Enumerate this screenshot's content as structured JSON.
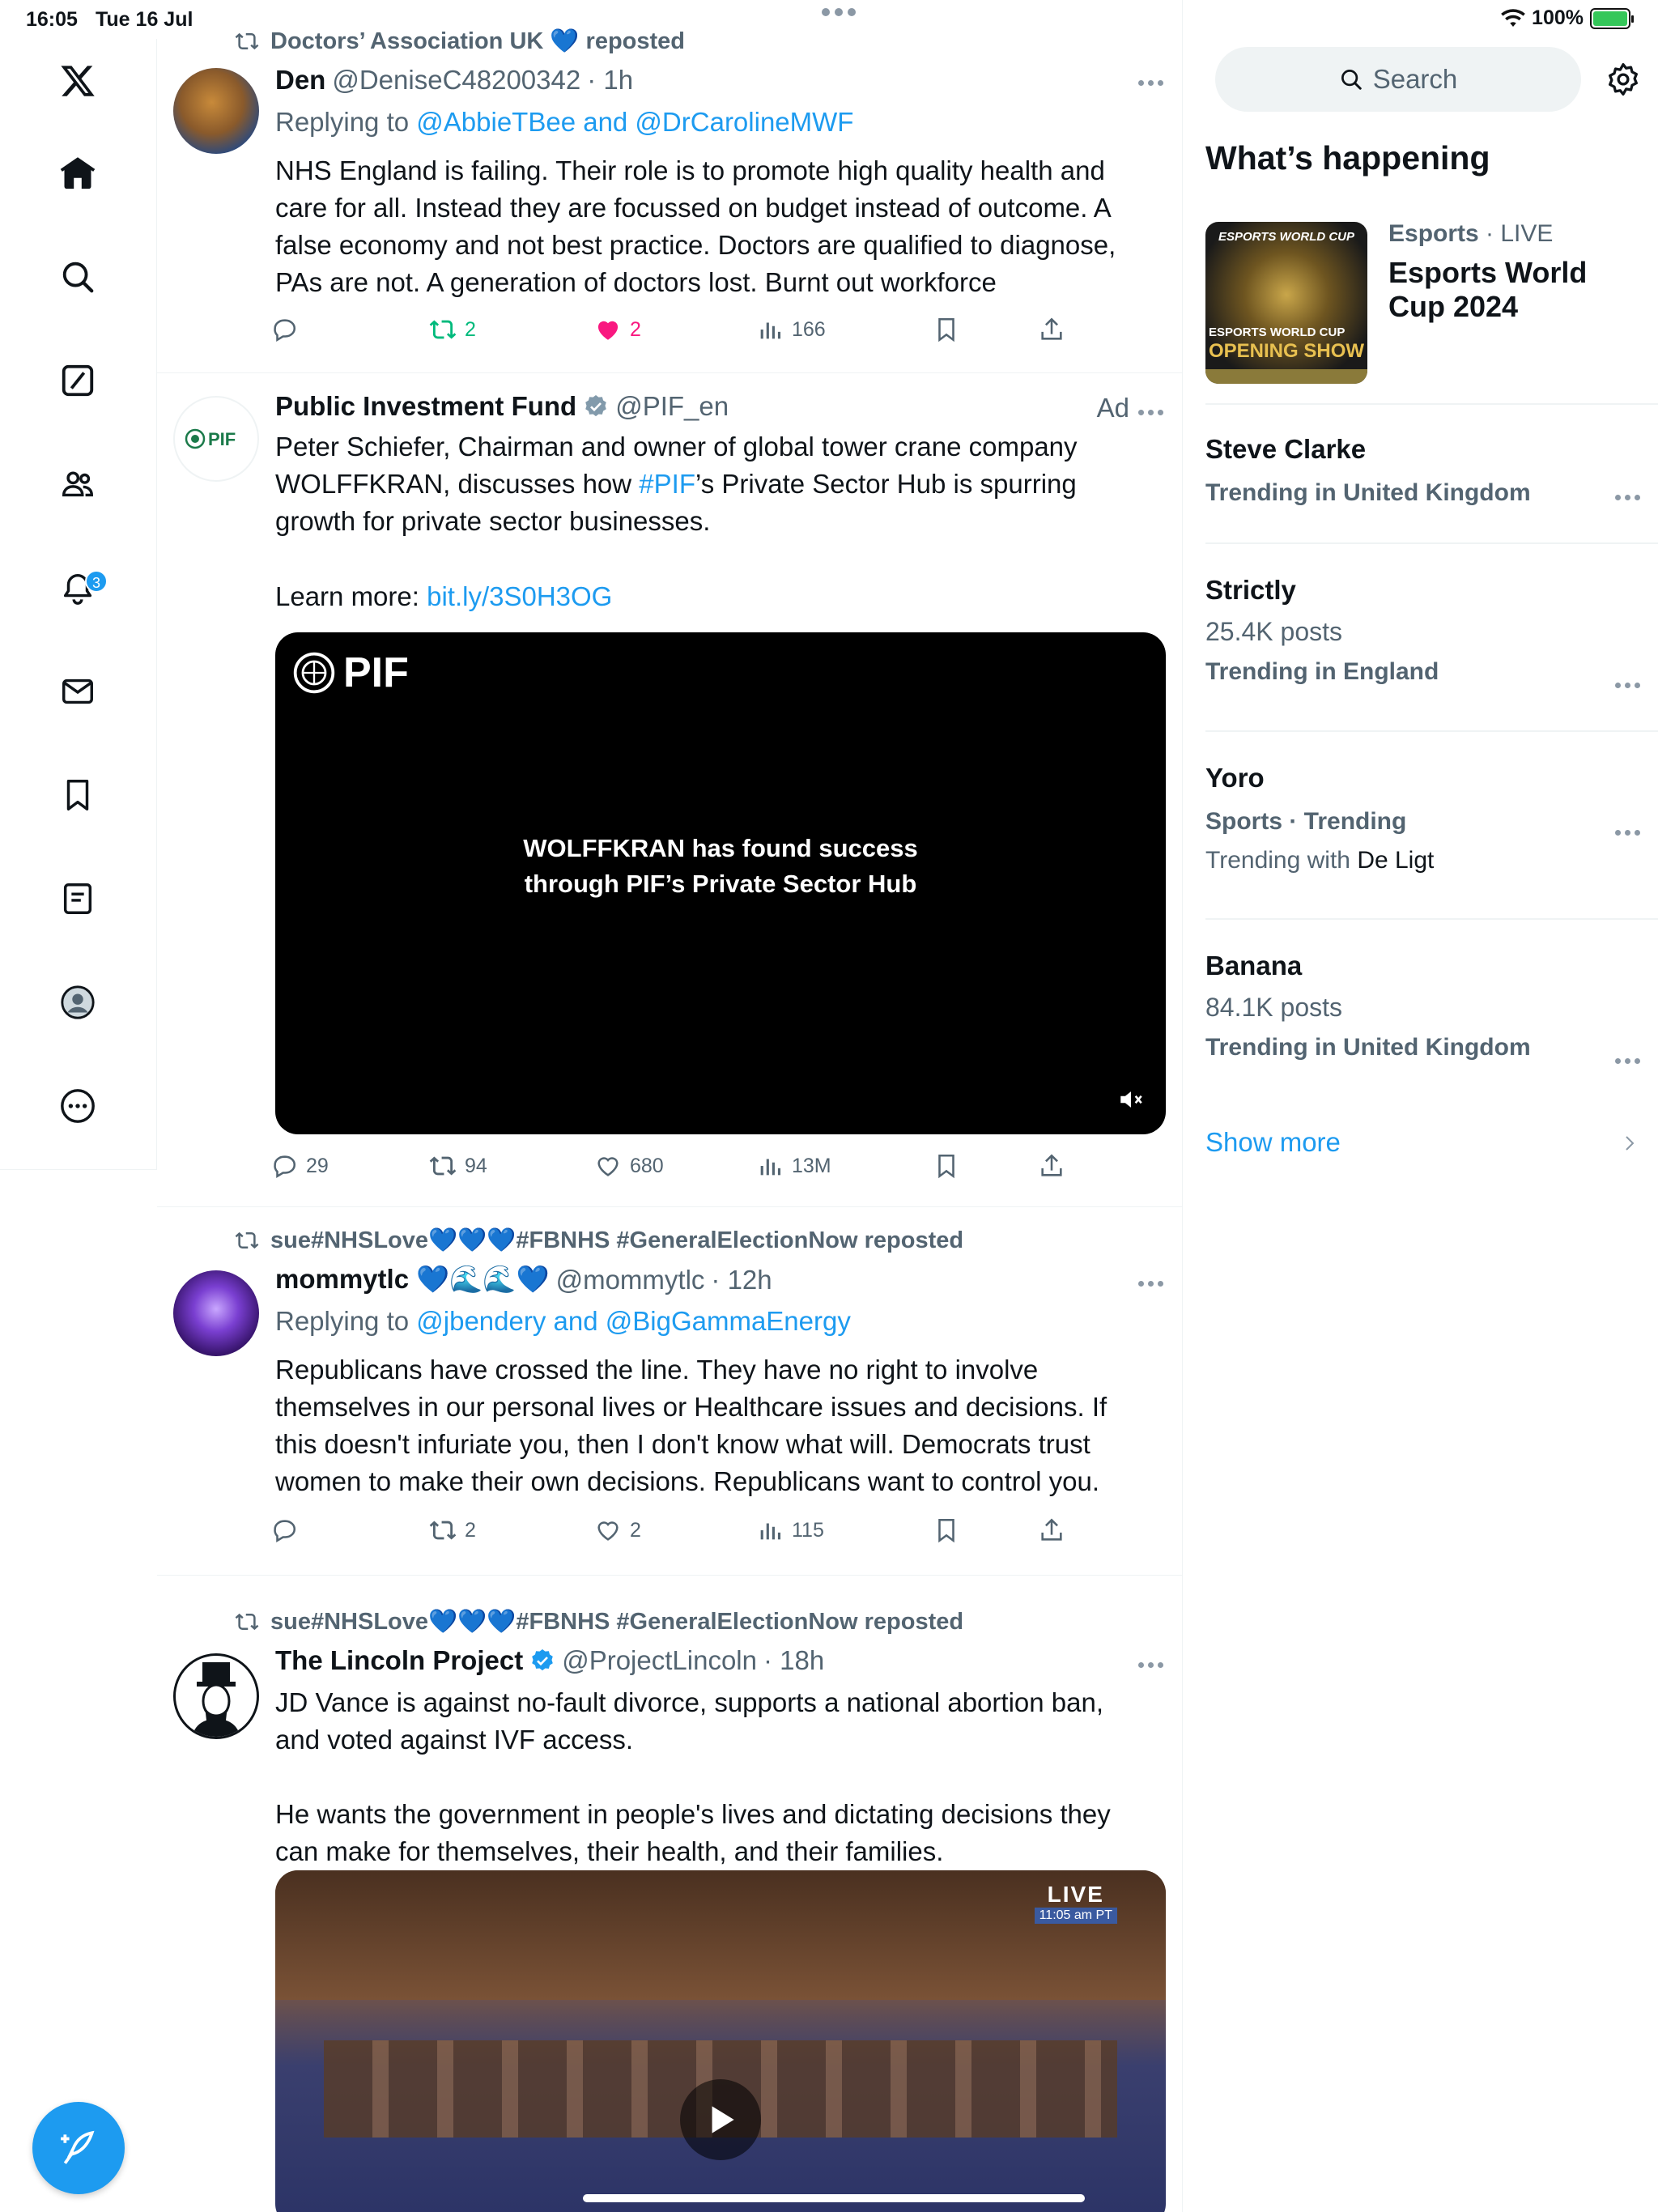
{
  "status_bar": {
    "time": "16:05",
    "date": "Tue 16 Jul",
    "battery": "100%"
  },
  "nav": {
    "notification_count": "3"
  },
  "tweets": [
    {
      "repost_by": "Doctors’ Association UK 💙 reposted",
      "name": "Den",
      "handle": "@DeniseC48200342",
      "time": "· 1h",
      "reply_prefix": "Replying to ",
      "reply_to": "@AbbieTBee and @DrCarolineMWF",
      "text": "NHS England is failing. Their role is to promote high quality health and care for all. Instead they are focussed on budget instead of outcome. A false economy and not best practice. Doctors are qualified to diagnose, PAs are not. A generation of doctors lost. Burnt out workforce",
      "retweets": "2",
      "likes": "2",
      "views": "166"
    },
    {
      "name": "Public Investment Fund",
      "handle": "@PIF_en",
      "ad_label": "Ad",
      "text_1": "Peter Schiefer, Chairman and owner of global tower crane company WOLFFKRAN, discusses how ",
      "hashtag": "#PIF",
      "text_2": "’s Private Sector Hub is spurring growth for private sector businesses.",
      "learn_more": "Learn more: ",
      "link": "bit.ly/3S0H3OG",
      "video_logo": "PIF",
      "video_caption_1": "WOLFFKRAN has found success",
      "video_caption_2": "through PIF’s Private Sector Hub",
      "replies": "29",
      "retweets": "94",
      "likes": "680",
      "views": "13M"
    },
    {
      "repost_by": "sue#NHSLove💙💙💙#FBNHS #GeneralElectionNow reposted",
      "name": "mommytlc 💙🌊🌊💙",
      "handle": "@mommytlc",
      "time": "· 12h",
      "reply_prefix": "Replying to ",
      "reply_to": "@jbendery and @BigGammaEnergy",
      "text": "Republicans have crossed the line. They have no right to involve themselves in our personal lives or Healthcare issues and decisions. If this doesn't infuriate you, then I don't know what will. Democrats trust women to make their own decisions. Republicans want to control you.",
      "retweets": "2",
      "likes": "2",
      "views": "115"
    },
    {
      "repost_by": "sue#NHSLove💙💙💙#FBNHS #GeneralElectionNow reposted",
      "name": "The Lincoln Project",
      "handle": "@ProjectLincoln",
      "time": "· 18h",
      "text": "JD Vance is against no-fault divorce, supports a national abortion ban, and voted against IVF access.\n\nHe wants the government in people's lives and dictating decisions they can make for themselves, their health, and their families.",
      "video_live_label": "LIVE",
      "video_time": "11:05 am PT"
    }
  ],
  "right": {
    "search_placeholder": "Search",
    "section_title": "What’s happening",
    "esports": {
      "category": "Esports",
      "status": " · LIVE",
      "title": "Esports World Cup 2024",
      "thumb_top": "ESPORTS WORLD CUP",
      "thumb_bottom_1": "ESPORTS WORLD CUP",
      "thumb_bottom_2": "OPENING SHOW"
    },
    "trends": [
      {
        "title": "Steve Clarke",
        "context": "Trending in United Kingdom"
      },
      {
        "title": "Strictly",
        "posts": "25.4K posts",
        "context": "Trending in England"
      },
      {
        "title": "Yoro",
        "context": "Sports · Trending",
        "with_prefix": "Trending with ",
        "with": "De Ligt"
      },
      {
        "title": "Banana",
        "posts": "84.1K posts",
        "context": "Trending in United Kingdom"
      }
    ],
    "show_more": "Show more"
  },
  "colors": {
    "accent": "#1d9bf0",
    "like_pink": "#f91880",
    "retweet_green": "#00ba7c",
    "text_secondary": "#536471"
  }
}
